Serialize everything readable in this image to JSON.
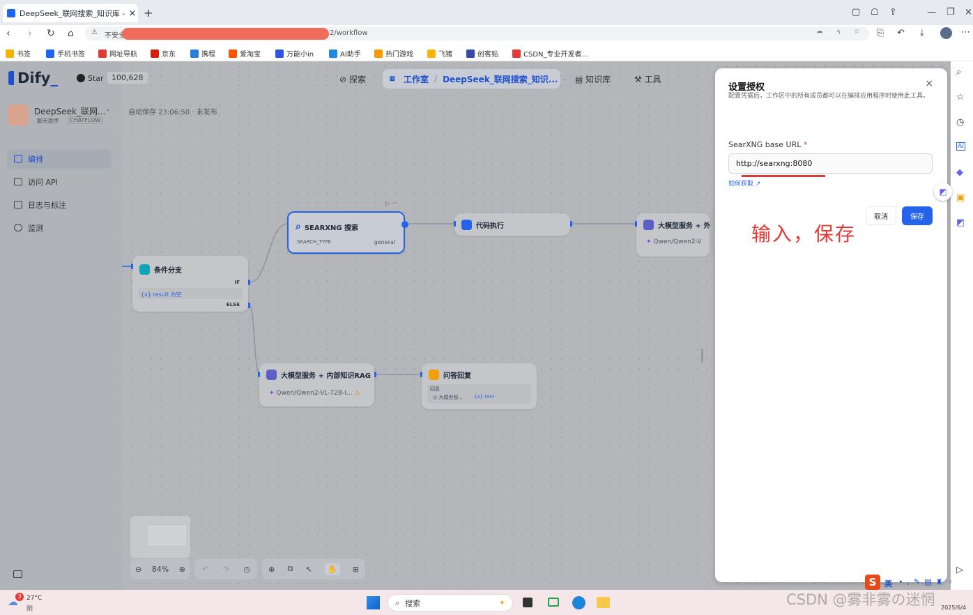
{
  "browser": {
    "tab_title": "DeepSeek_联网搜索_知识库 - Di",
    "tab_close": "×",
    "new_tab": "+",
    "security": "不安全",
    "url_suffix": "2/workflow",
    "bookmarks": [
      {
        "label": "书签",
        "color": "#f4b400"
      },
      {
        "label": "手机书签",
        "color": "#1c64f2"
      },
      {
        "label": "网址导航",
        "color": "#e53935"
      },
      {
        "label": "京东",
        "color": "#d81e06"
      },
      {
        "label": "携程",
        "color": "#2a7de1"
      },
      {
        "label": "爱淘宝",
        "color": "#ff5000"
      },
      {
        "label": "万能小in",
        "color": "#2f54eb"
      },
      {
        "label": "AI助手",
        "color": "#1e88e5"
      },
      {
        "label": "热门游戏",
        "color": "#ff9800"
      },
      {
        "label": "飞猪",
        "color": "#ffb300"
      },
      {
        "label": "创客贴",
        "color": "#3949ab"
      },
      {
        "label": "CSDN_专业开发者...",
        "color": "#e53935"
      }
    ]
  },
  "sidebar": {
    "logo": "Dify",
    "star_label": "Star",
    "star_count": "100,628",
    "app_name": "DeepSeek_联网...",
    "app_type": "聊天助手",
    "app_mode": "CHATFLOW",
    "items": [
      {
        "label": "编排",
        "active": true
      },
      {
        "label": "访问 API"
      },
      {
        "label": "日志与标注"
      },
      {
        "label": "监测"
      }
    ]
  },
  "topnav": {
    "explore": "探索",
    "studio": "工作室",
    "separator": "/",
    "app": "DeepSeek_联网搜索_知识...",
    "knowledge": "知识库",
    "tools": "工具"
  },
  "autosave": "自动保存 23:06:50 · 未发布",
  "nodes": {
    "searxng": {
      "title": "SEARXNG 搜索",
      "param": "SEARCH_TYPE",
      "value": "general"
    },
    "code": {
      "title": "代码执行"
    },
    "llm_top": {
      "title": "大模型服务 + 外",
      "model": "Qwen/Qwen2-V"
    },
    "ifelse": {
      "title": "条件分支",
      "if_label": "IF",
      "else_label": "ELSE",
      "cond": "{x} result 为空"
    },
    "llm_rag": {
      "title": "大模型服务 + 内部知识RAG",
      "model": "Qwen/Qwen2-VL-72B-I..."
    },
    "answer": {
      "title": "问答回复",
      "reply_label": "回复",
      "var_src": "大模型服...",
      "var_name": "{x} text"
    }
  },
  "toolbar": {
    "zoom": "84%"
  },
  "dialog": {
    "title": "设置授权",
    "desc": "配置凭据后，工作区中的所有成员都可以在编排应用程序时使用此工具。",
    "close": "×",
    "field_label": "SearXNG base URL",
    "required_mark": "*",
    "field_value": "http://searxng:8080",
    "help_link": "如何获取",
    "cancel": "取消",
    "save": "保存"
  },
  "annotation": "输入，保存",
  "taskbar": {
    "weather_temp": "27°C",
    "weather_desc": "阴",
    "weather_badge": "3",
    "search": "搜索",
    "ime": "英",
    "date": "2025/6/4"
  },
  "watermark": "CSDN @雾非雾の迷惘"
}
